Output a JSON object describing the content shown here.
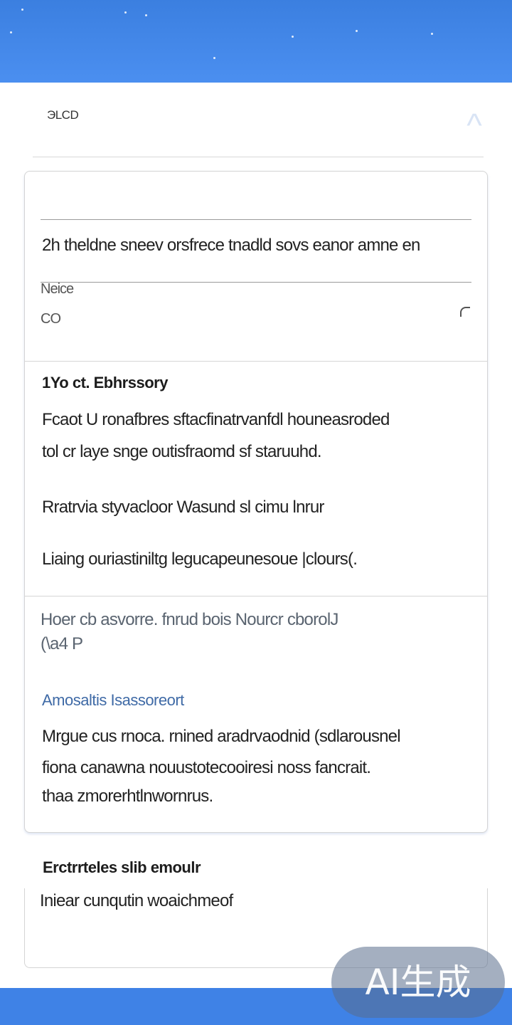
{
  "header": {
    "title": "ЭLCD",
    "chevron": "^"
  },
  "card": {
    "row1_text": "2h theldne sneev orsfrece tnadld sovs eanor amne en",
    "field_label": "Neice",
    "field_value": "CO",
    "section1": {
      "heading": "1Yo ct. Ebhrssory",
      "lines": [
        "Fcaot U ronafbres sftacfinatrvanfdl houneasroded",
        "tol cr laye snge outisfraomd sf staruuhd.",
        "Rratrvia styvacloor Wasund sl cimu lnrur",
        "Liaing ouriastiniltg legucapeunesoue |clours(."
      ]
    },
    "section2": {
      "muted_line1": "Hoer cb asvorre. fnrud bois Nourcr   cborolJ",
      "muted_line2": "(\\a4 P",
      "accent_heading": "Amosaltis Isassoreort",
      "lines": [
        "Mrgue cus rnoca. rnined aradrvaodnid (sdlarousnel",
        "fiona canawna nouustotecooiresi noss fancrait.",
        "thaa zmorerhtlnwornrus."
      ]
    }
  },
  "bottom": {
    "heading": "Erctrrteles slib emoulr",
    "line": "Iniear cunqutin woaichmeof"
  },
  "watermark": "AI生成",
  "colors": {
    "banner": "#3b7fe0",
    "accent": "#3f6aa6",
    "bottom_bar": "#3f82e6"
  }
}
